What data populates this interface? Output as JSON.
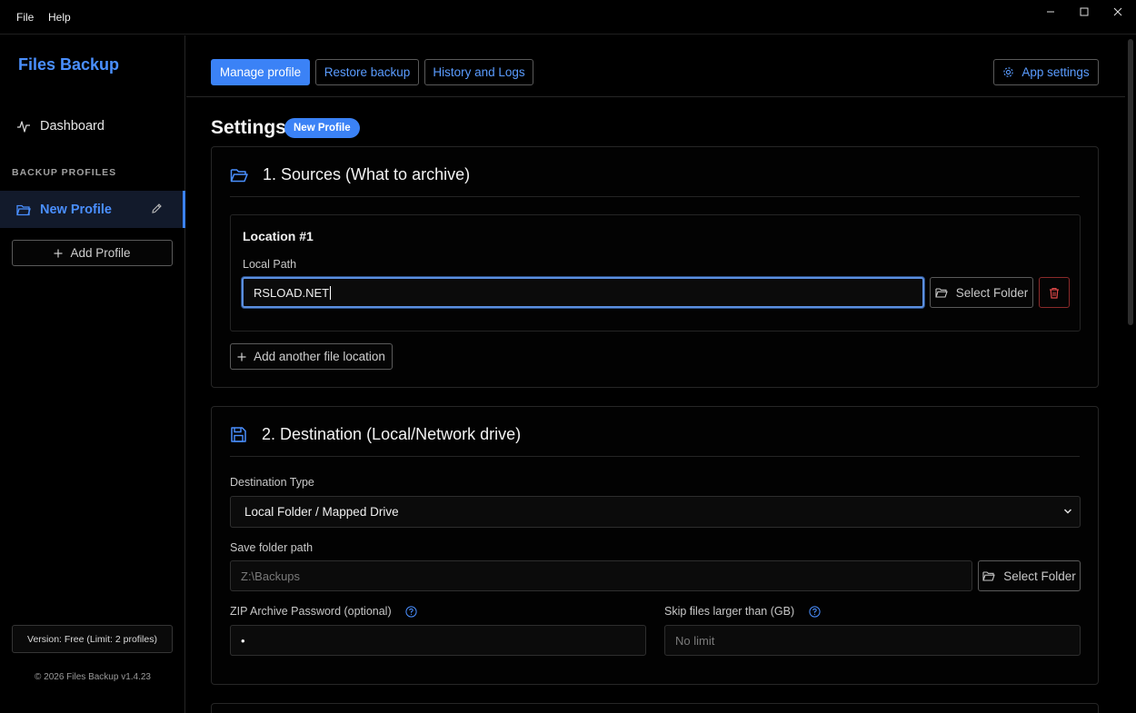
{
  "menu": {
    "file": "File",
    "help": "Help"
  },
  "sidebar": {
    "brand": "Files Backup",
    "dashboard": "Dashboard",
    "section_label": "BACKUP PROFILES",
    "profile": "New Profile",
    "add_profile": "Add Profile",
    "version": "Version: Free (Limit: 2 profiles)",
    "copyright": "© 2026 Files Backup v1.4.23"
  },
  "tabs": {
    "manage": "Manage profile",
    "restore": "Restore backup",
    "history": "History and Logs",
    "app_settings": "App settings"
  },
  "page": {
    "title": "Settings",
    "badge": "New Profile"
  },
  "sources": {
    "title": "1. Sources (What to archive)",
    "location_title": "Location #1",
    "local_path_label": "Local Path",
    "local_path_value": "RSLOAD.NET",
    "select_folder": "Select Folder",
    "add_location": "Add another file location"
  },
  "destination": {
    "title": "2. Destination (Local/Network drive)",
    "type_label": "Destination Type",
    "type_value": "Local Folder / Mapped Drive",
    "save_path_label": "Save folder path",
    "save_path_placeholder": "Z:\\Backups",
    "select_folder": "Select Folder",
    "zip_label": "ZIP Archive Password (optional)",
    "zip_value": "•",
    "skip_label": "Skip files larger than (GB)",
    "skip_placeholder": "No limit"
  },
  "colors": {
    "accent": "#3b82f6",
    "danger": "#e04848"
  }
}
